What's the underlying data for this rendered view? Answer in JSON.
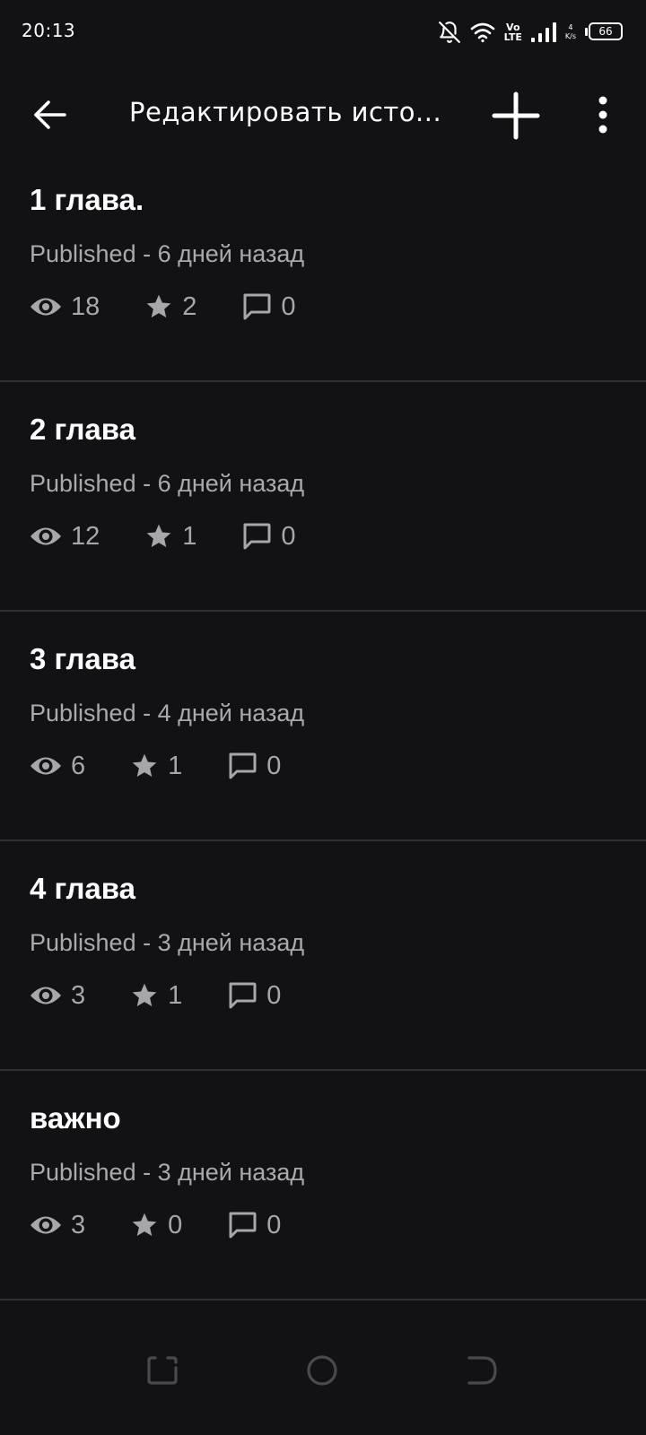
{
  "status_bar": {
    "time": "20:13",
    "volte_top": "Vo",
    "volte_bottom": "LTE",
    "net_speed_value": "4",
    "net_speed_unit": "K/s",
    "battery": "66"
  },
  "app_bar": {
    "title": "Редактировать исто..."
  },
  "parts": [
    {
      "title": "1 глава.",
      "status": "Published - 6 дней назад",
      "views": "18",
      "votes": "2",
      "comments": "0"
    },
    {
      "title": "2 глава",
      "status": "Published - 6 дней назад",
      "views": "12",
      "votes": "1",
      "comments": "0"
    },
    {
      "title": "3 глава",
      "status": "Published - 4 дней назад",
      "views": "6",
      "votes": "1",
      "comments": "0"
    },
    {
      "title": "4 глава",
      "status": "Published - 3 дней назад",
      "views": "3",
      "votes": "1",
      "comments": "0"
    },
    {
      "title": "важно",
      "status": "Published - 3 дней назад",
      "views": "3",
      "votes": "0",
      "comments": "0"
    }
  ],
  "icons": {
    "muted_notifications": "bell-off-icon",
    "wifi": "wifi-icon",
    "signal": "signal-icon",
    "battery": "battery-icon",
    "back": "arrow-left-icon",
    "add": "plus-icon",
    "more": "more-vert-icon",
    "views": "eye-icon",
    "votes": "star-icon",
    "comments": "comment-icon"
  },
  "colors": {
    "background": "#121114",
    "divider": "#303034",
    "text_primary": "#ffffff",
    "text_secondary": "#aaaaae"
  }
}
